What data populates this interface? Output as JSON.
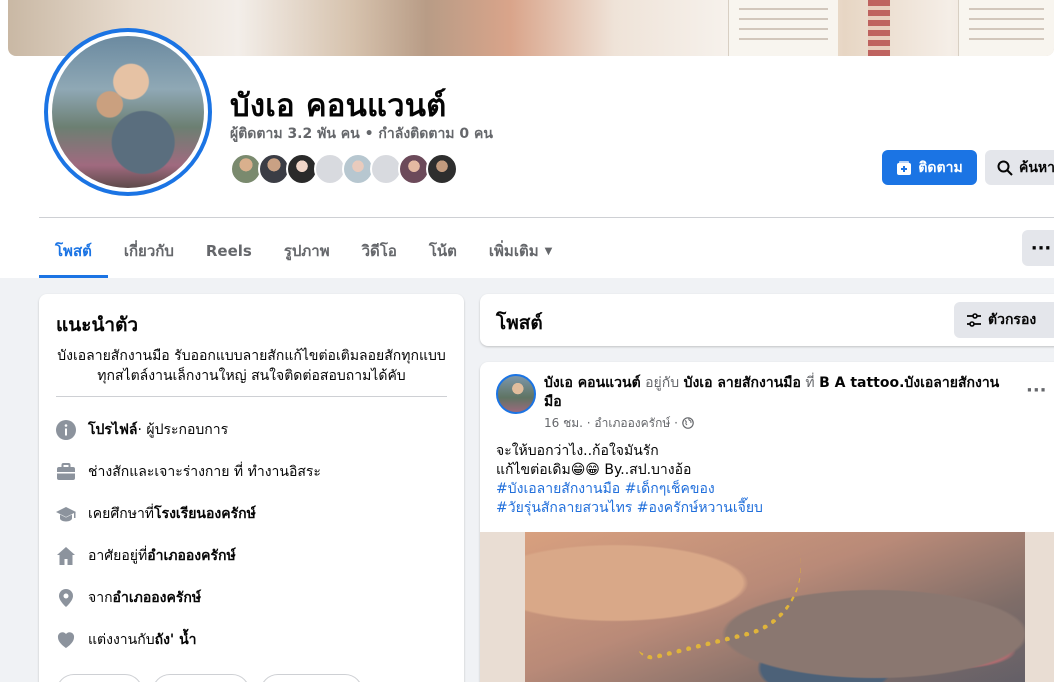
{
  "profile": {
    "name": "บังเอ คอนแวนต์",
    "stats": "ผู้ติดตาม 3.2 พัน คน • กำลังติดตาม 0 คน"
  },
  "actions": {
    "follow_label": "ติดตาม",
    "search_label": "ค้นหา"
  },
  "tabs": [
    {
      "label": "โพสต์"
    },
    {
      "label": "เกี่ยวกับ"
    },
    {
      "label": "Reels"
    },
    {
      "label": "รูปภาพ"
    },
    {
      "label": "วิดีโอ"
    },
    {
      "label": "โน้ต"
    },
    {
      "label": "เพิ่มเติม"
    }
  ],
  "intro": {
    "title": "แนะนำตัว",
    "bio": "บังเอลายสักงานมือ รับออกแบบลายสักแก้ไขต่อเติมลอยสักทุกแบบทุกสไตล์งานเล็กงานใหญ่ สนใจติดต่อสอบถามได้คับ",
    "rows": [
      {
        "icon": "info-icon",
        "bold": "โปรไฟล์",
        "text": " · ผู้ประกอบการ"
      },
      {
        "icon": "briefcase-icon",
        "text": "ช่างสักและเจาะร่างกาย ที่ ทำงานอิสระ"
      },
      {
        "icon": "graduation-cap-icon",
        "text": "เคยศึกษาที่ ",
        "bold": "โรงเรียนองครักษ์"
      },
      {
        "icon": "home-icon",
        "text": "อาศัยอยู่ที่ ",
        "bold": "อำเภอองครักษ์"
      },
      {
        "icon": "location-pin-icon",
        "text": "จาก ",
        "bold": "อำเภอองครักษ์"
      },
      {
        "icon": "heart-icon",
        "text": "แต่งงานกับ ",
        "bold": "ถัง' น้ำ"
      }
    ]
  },
  "posts": {
    "header_title": "โพสต์",
    "filter_label": "ตัวกรอง",
    "post": {
      "author": "บังเอ คอนแวนต์",
      "with_text": " อยู่กับ ",
      "with_name": "บังเอ ลายสักงานมือ",
      "at_text": " ที่ ",
      "place": "B A tattoo.บังเอลายสักงานมือ",
      "time": "16 ชม.",
      "location": "อำเภอองครักษ์",
      "line1": "จะให้บอกว่าไง..ก้อใจมันรัก",
      "line2": "แก้ไขต่อเดิม😁😁 By..สป.บางอ้อ",
      "hashtags1": "#บังเอลายสักงานมือ #เด็กๆเช็คของ",
      "hashtags2": "#วัยรุ่นสักลายสวนไทร #องครักษ์หวานเจี๊ยบ"
    }
  },
  "colors": {
    "accent": "#1b74e4",
    "background": "#f0f2f5",
    "hashtag": "#216fdb"
  }
}
